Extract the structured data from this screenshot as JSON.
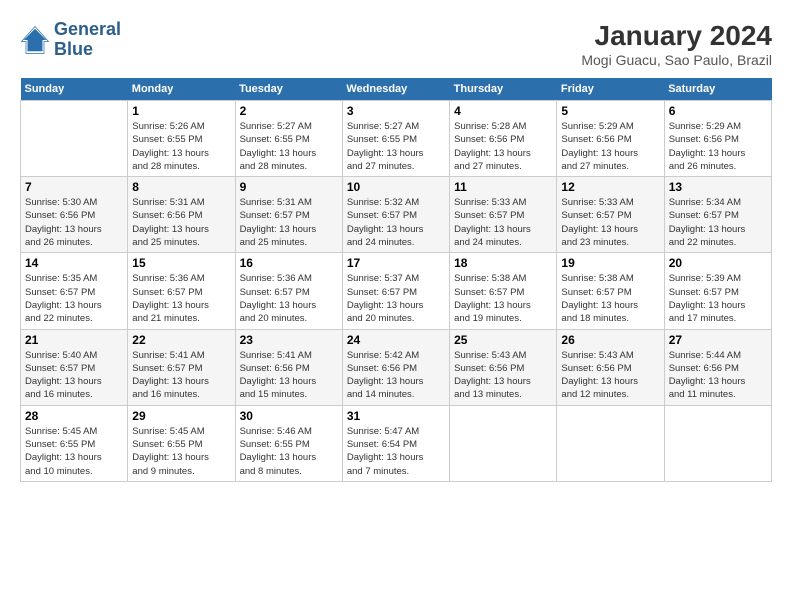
{
  "header": {
    "logo_line1": "General",
    "logo_line2": "Blue",
    "title": "January 2024",
    "subtitle": "Mogi Guacu, Sao Paulo, Brazil"
  },
  "days_of_week": [
    "Sunday",
    "Monday",
    "Tuesday",
    "Wednesday",
    "Thursday",
    "Friday",
    "Saturday"
  ],
  "weeks": [
    [
      {
        "num": "",
        "info": ""
      },
      {
        "num": "1",
        "info": "Sunrise: 5:26 AM\nSunset: 6:55 PM\nDaylight: 13 hours\nand 28 minutes."
      },
      {
        "num": "2",
        "info": "Sunrise: 5:27 AM\nSunset: 6:55 PM\nDaylight: 13 hours\nand 28 minutes."
      },
      {
        "num": "3",
        "info": "Sunrise: 5:27 AM\nSunset: 6:55 PM\nDaylight: 13 hours\nand 27 minutes."
      },
      {
        "num": "4",
        "info": "Sunrise: 5:28 AM\nSunset: 6:56 PM\nDaylight: 13 hours\nand 27 minutes."
      },
      {
        "num": "5",
        "info": "Sunrise: 5:29 AM\nSunset: 6:56 PM\nDaylight: 13 hours\nand 27 minutes."
      },
      {
        "num": "6",
        "info": "Sunrise: 5:29 AM\nSunset: 6:56 PM\nDaylight: 13 hours\nand 26 minutes."
      }
    ],
    [
      {
        "num": "7",
        "info": "Sunrise: 5:30 AM\nSunset: 6:56 PM\nDaylight: 13 hours\nand 26 minutes."
      },
      {
        "num": "8",
        "info": "Sunrise: 5:31 AM\nSunset: 6:56 PM\nDaylight: 13 hours\nand 25 minutes."
      },
      {
        "num": "9",
        "info": "Sunrise: 5:31 AM\nSunset: 6:57 PM\nDaylight: 13 hours\nand 25 minutes."
      },
      {
        "num": "10",
        "info": "Sunrise: 5:32 AM\nSunset: 6:57 PM\nDaylight: 13 hours\nand 24 minutes."
      },
      {
        "num": "11",
        "info": "Sunrise: 5:33 AM\nSunset: 6:57 PM\nDaylight: 13 hours\nand 24 minutes."
      },
      {
        "num": "12",
        "info": "Sunrise: 5:33 AM\nSunset: 6:57 PM\nDaylight: 13 hours\nand 23 minutes."
      },
      {
        "num": "13",
        "info": "Sunrise: 5:34 AM\nSunset: 6:57 PM\nDaylight: 13 hours\nand 22 minutes."
      }
    ],
    [
      {
        "num": "14",
        "info": "Sunrise: 5:35 AM\nSunset: 6:57 PM\nDaylight: 13 hours\nand 22 minutes."
      },
      {
        "num": "15",
        "info": "Sunrise: 5:36 AM\nSunset: 6:57 PM\nDaylight: 13 hours\nand 21 minutes."
      },
      {
        "num": "16",
        "info": "Sunrise: 5:36 AM\nSunset: 6:57 PM\nDaylight: 13 hours\nand 20 minutes."
      },
      {
        "num": "17",
        "info": "Sunrise: 5:37 AM\nSunset: 6:57 PM\nDaylight: 13 hours\nand 20 minutes."
      },
      {
        "num": "18",
        "info": "Sunrise: 5:38 AM\nSunset: 6:57 PM\nDaylight: 13 hours\nand 19 minutes."
      },
      {
        "num": "19",
        "info": "Sunrise: 5:38 AM\nSunset: 6:57 PM\nDaylight: 13 hours\nand 18 minutes."
      },
      {
        "num": "20",
        "info": "Sunrise: 5:39 AM\nSunset: 6:57 PM\nDaylight: 13 hours\nand 17 minutes."
      }
    ],
    [
      {
        "num": "21",
        "info": "Sunrise: 5:40 AM\nSunset: 6:57 PM\nDaylight: 13 hours\nand 16 minutes."
      },
      {
        "num": "22",
        "info": "Sunrise: 5:41 AM\nSunset: 6:57 PM\nDaylight: 13 hours\nand 16 minutes."
      },
      {
        "num": "23",
        "info": "Sunrise: 5:41 AM\nSunset: 6:56 PM\nDaylight: 13 hours\nand 15 minutes."
      },
      {
        "num": "24",
        "info": "Sunrise: 5:42 AM\nSunset: 6:56 PM\nDaylight: 13 hours\nand 14 minutes."
      },
      {
        "num": "25",
        "info": "Sunrise: 5:43 AM\nSunset: 6:56 PM\nDaylight: 13 hours\nand 13 minutes."
      },
      {
        "num": "26",
        "info": "Sunrise: 5:43 AM\nSunset: 6:56 PM\nDaylight: 13 hours\nand 12 minutes."
      },
      {
        "num": "27",
        "info": "Sunrise: 5:44 AM\nSunset: 6:56 PM\nDaylight: 13 hours\nand 11 minutes."
      }
    ],
    [
      {
        "num": "28",
        "info": "Sunrise: 5:45 AM\nSunset: 6:55 PM\nDaylight: 13 hours\nand 10 minutes."
      },
      {
        "num": "29",
        "info": "Sunrise: 5:45 AM\nSunset: 6:55 PM\nDaylight: 13 hours\nand 9 minutes."
      },
      {
        "num": "30",
        "info": "Sunrise: 5:46 AM\nSunset: 6:55 PM\nDaylight: 13 hours\nand 8 minutes."
      },
      {
        "num": "31",
        "info": "Sunrise: 5:47 AM\nSunset: 6:54 PM\nDaylight: 13 hours\nand 7 minutes."
      },
      {
        "num": "",
        "info": ""
      },
      {
        "num": "",
        "info": ""
      },
      {
        "num": "",
        "info": ""
      }
    ]
  ]
}
